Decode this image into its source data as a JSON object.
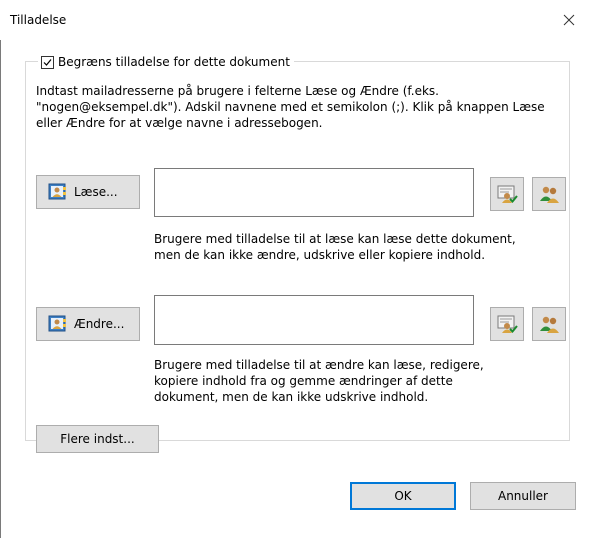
{
  "window": {
    "title": "Tilladelse"
  },
  "restrict": {
    "checkbox_label": "Begræns tilladelse for dette dokument",
    "checked": true
  },
  "instructions": [
    "Indtast mailadresserne på brugere i felterne Læse og Ændre (f.eks.",
    "\"nogen@eksempel.dk\"). Adskil navnene med et semikolon (;). Klik på knappen Læse",
    "eller Ændre for at vælge navne i adressebogen."
  ],
  "read": {
    "button_label": "Læse...",
    "field_value": "",
    "description": [
      "Brugere med tilladelse til at læse kan læse dette dokument,",
      "men de kan ikke ændre, udskrive eller kopiere indhold."
    ]
  },
  "change": {
    "button_label": "Ændre...",
    "field_value": "",
    "description": [
      "Brugere med tilladelse til at ændre kan læse, redigere,",
      "kopiere indhold fra og gemme ændringer af dette",
      "dokument, men de kan ikke udskrive indhold."
    ]
  },
  "more_options_label": "Flere indst...",
  "ok_label": "OK",
  "cancel_label": "Annuller",
  "icons": {
    "addressbook": "address-book-icon",
    "check_names": "check-names-icon",
    "users": "users-icon",
    "close": "close-icon"
  },
  "colors": {
    "accent": "#0078d7",
    "button_bg": "#e1e1e1",
    "button_border": "#adadad"
  }
}
